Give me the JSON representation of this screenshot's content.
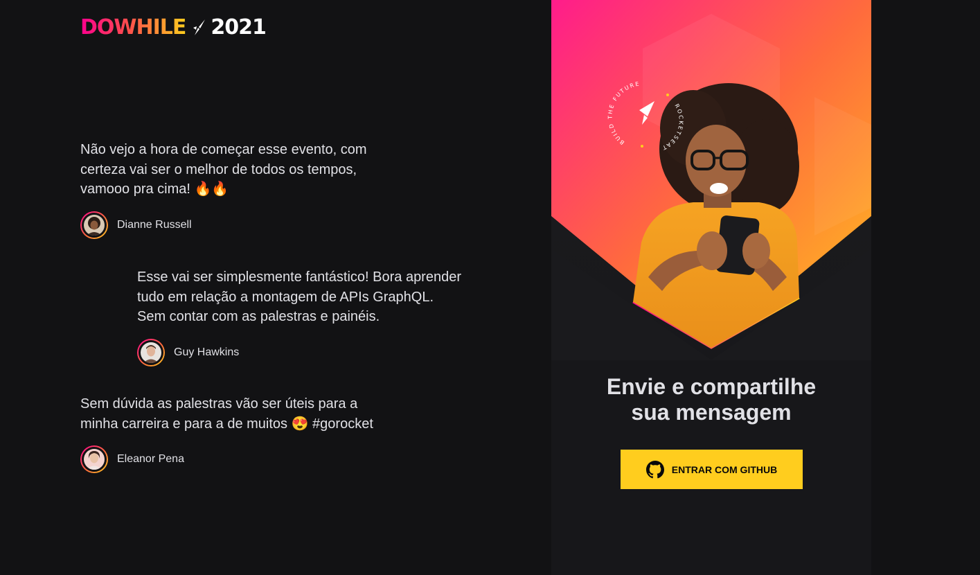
{
  "logo": {
    "dowhile": "DOWHILE",
    "year": "2021"
  },
  "messages": [
    {
      "text": "Não vejo a hora de começar esse evento, com certeza vai ser o melhor de todos os tempos, vamooo pra cima! 🔥🔥",
      "user": "Dianne Russell"
    },
    {
      "text": "Esse vai ser simplesmente fantástico! Bora aprender tudo em relação a montagem de APIs GraphQL. Sem contar com as palestras e painéis.",
      "user": "Guy Hawkins"
    },
    {
      "text": "Sem dúvida as palestras vão ser úteis para a minha carreira e para a de muitos 😍 #gorocket",
      "user": "Eleanor Pena"
    }
  ],
  "panel": {
    "badge": {
      "arc_text": "BUILD THE FUTURE",
      "side_text": "ROCKETSEAT"
    },
    "title_line1": "Envie e compartilhe",
    "title_line2": "sua mensagem",
    "button_label": "ENTRAR COM GITHUB"
  },
  "icons": {
    "logo": "rocket-icon",
    "button": "github-icon"
  },
  "colors": {
    "background": "#121214",
    "panel": "#17171a",
    "accent_pink": "#ff008e",
    "accent_yellow": "#ffcd1e",
    "text": "#e1e1e6"
  }
}
